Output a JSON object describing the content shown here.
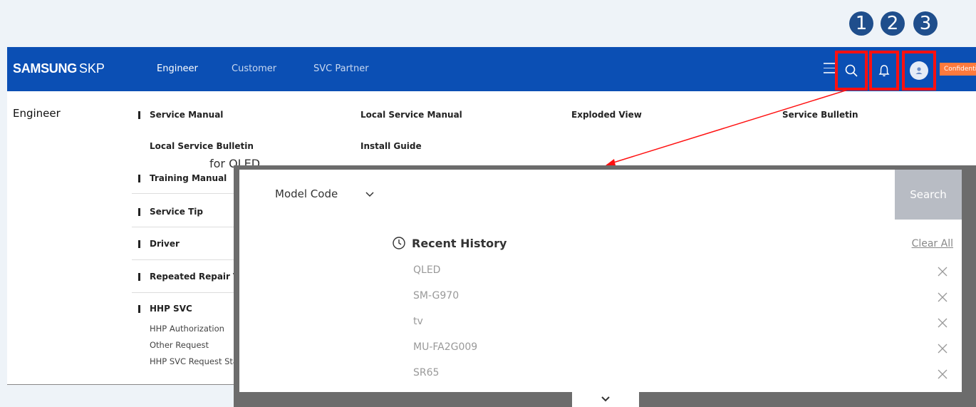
{
  "callouts": [
    "1",
    "2",
    "3"
  ],
  "header": {
    "logo_brand": "SAMSUNG",
    "logo_product": "SKP",
    "nav": [
      "Engineer",
      "Customer",
      "SVC Partner"
    ],
    "badge": "Confidential",
    "icons": [
      "menu-icon",
      "search-icon",
      "bell-icon",
      "user-icon"
    ]
  },
  "mega_menu": {
    "title": "Engineer",
    "row1": [
      "Service Manual",
      "Local Service Manual",
      "Exploded View",
      "Service Bulletin"
    ],
    "row2": [
      "Local Service Bulletin",
      "Install Guide"
    ],
    "sections": [
      "Training Manual",
      "Service Tip",
      "Driver",
      "Repeated Repair Tip",
      "HHP SVC"
    ],
    "hhp_sub": [
      "HHP Authorization",
      "Other Request",
      "HHP SVC Request Statu"
    ],
    "behind_text": "for QLED"
  },
  "search_panel": {
    "model_label": "Model Code",
    "search_button": "Search",
    "recent_title": "Recent History",
    "clear_all": "Clear All",
    "history": [
      "QLED",
      "SM-G970",
      "tv",
      "MU-FA2G009",
      "SR65"
    ]
  },
  "colors": {
    "header_bg": "#0b4fb4",
    "callout_bg": "#1f4e8c",
    "highlight": "#ff1010",
    "badge": "#ff7a3d",
    "search_btn": "#b8bcc4"
  }
}
